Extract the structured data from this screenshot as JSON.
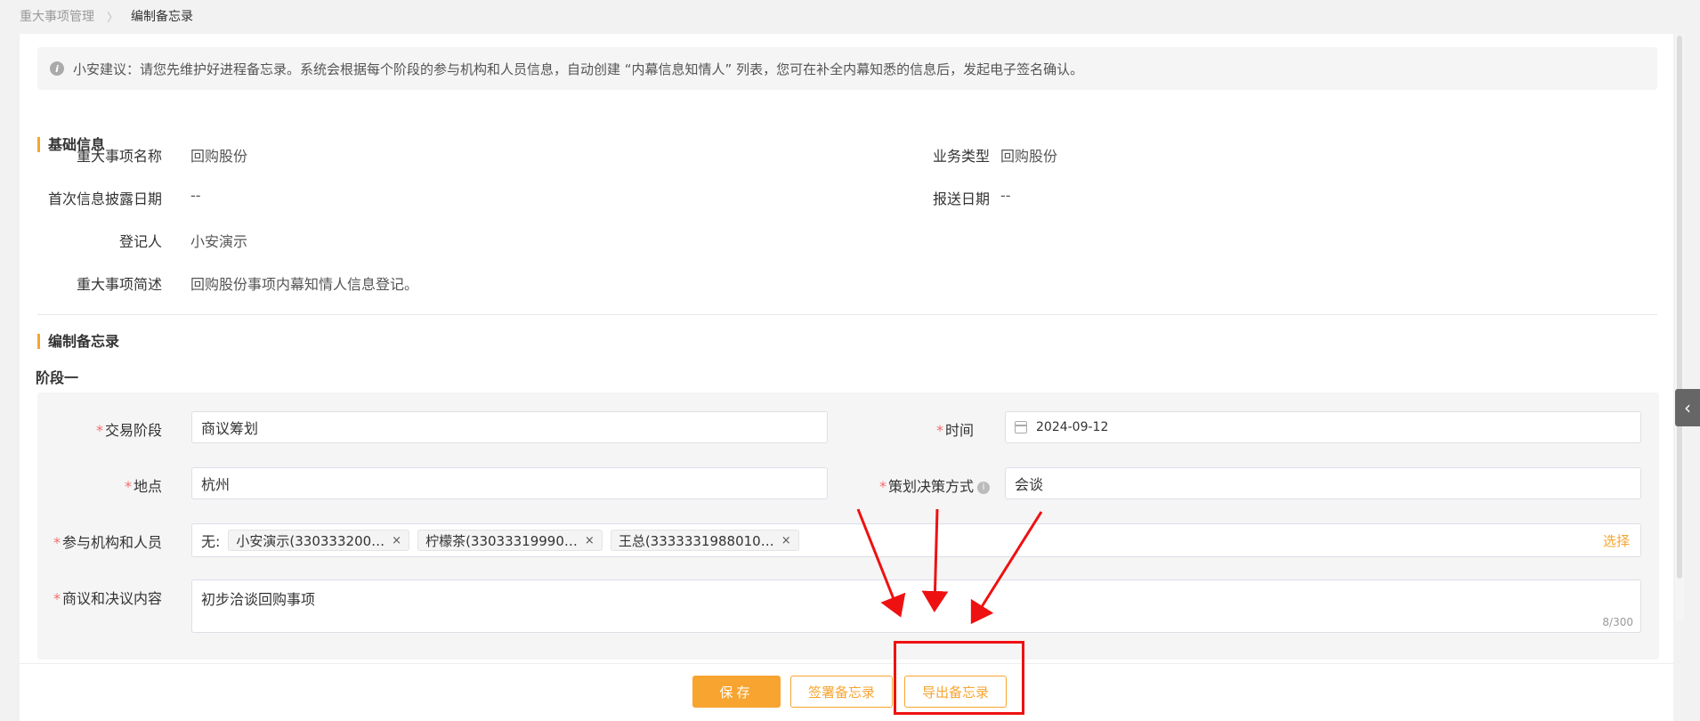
{
  "breadcrumb": {
    "parent": "重大事项管理",
    "separator": "〉",
    "current": "编制备忘录"
  },
  "tip": {
    "text": "小安建议：请您先维护好进程备忘录。系统会根据每个阶段的参与机构和人员信息，自动创建 “内幕信息知情人” 列表，您可在补全内幕知悉的信息后，发起电子签名确认。"
  },
  "basic": {
    "title": "基础信息",
    "fields": {
      "name_label": "重大事项名称",
      "name_value": "回购股份",
      "type_label": "业务类型",
      "type_value": "回购股份",
      "first_date_label": "首次信息披露日期",
      "first_date_value": "--",
      "send_date_label": "报送日期",
      "send_date_value": "--",
      "registrant_label": "登记人",
      "registrant_value": "小安演示",
      "summary_label": "重大事项简述",
      "summary_value": "回购股份事项内幕知情人信息登记。"
    }
  },
  "memo": {
    "title": "编制备忘录",
    "stage_title": "阶段一",
    "required_mark": "*",
    "trade_stage_label": "交易阶段",
    "trade_stage_value": "商议筹划",
    "time_label": "时间",
    "time_value": "2024-09-12",
    "place_label": "地点",
    "place_value": "杭州",
    "decision_label": "策划决策方式",
    "decision_value": "会谈",
    "participants_label": "参与机构和人员",
    "participants_prefix": "无:",
    "participants": [
      "小安演示(330333200…",
      "柠檬茶(33033319990…",
      "王总(3333331988010…"
    ],
    "tag_close": "×",
    "select_link": "选择",
    "content_label": "商议和决议内容",
    "content_value": "初步洽谈回购事项",
    "content_counter": "8/300"
  },
  "footer": {
    "save": "保存",
    "sign": "签署备忘录",
    "export": "导出备忘录"
  },
  "side_toggle": "‹",
  "colors": {
    "accent": "#f7a430",
    "required": "#f56c6c",
    "annotation": "#ee1111"
  }
}
